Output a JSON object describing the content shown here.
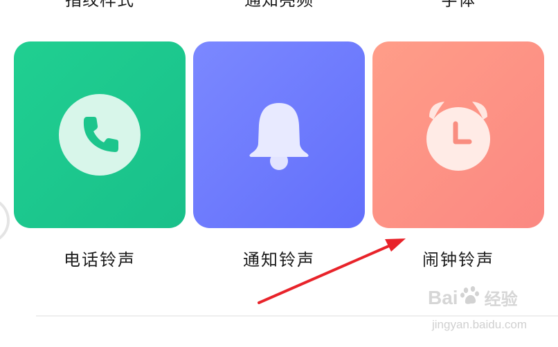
{
  "top_row": {
    "labels": [
      "指纹样式",
      "通知亮频",
      "字体"
    ]
  },
  "ringtones": [
    {
      "label": "电话铃声",
      "icon": "phone-icon",
      "color": "#1fc990"
    },
    {
      "label": "通知铃声",
      "icon": "bell-icon",
      "color": "#6f7cfd"
    },
    {
      "label": "闹钟铃声",
      "icon": "alarm-clock-icon",
      "color": "#fd9386"
    }
  ],
  "annotation": {
    "arrow_color": "#e8232a"
  },
  "watermark": {
    "brand_left": "Bai",
    "brand_right": "经验",
    "url": "jingyan.baidu.com"
  }
}
